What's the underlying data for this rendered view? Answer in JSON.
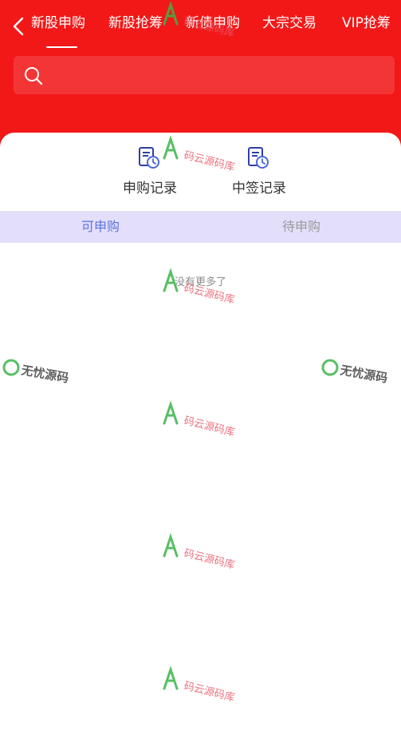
{
  "header": {
    "tabs": [
      {
        "label": "新股申购",
        "active": true
      },
      {
        "label": "新股抢筹",
        "active": false
      },
      {
        "label": "新债申购",
        "active": false
      },
      {
        "label": "大宗交易",
        "active": false
      },
      {
        "label": "VIP抢筹",
        "active": false
      }
    ],
    "search": {
      "placeholder": "",
      "value": ""
    }
  },
  "records": [
    {
      "label": "申购记录",
      "icon": "document-clock-icon"
    },
    {
      "label": "中签记录",
      "icon": "document-clock-icon"
    }
  ],
  "sub_tabs": [
    {
      "label": "可申购",
      "active": true
    },
    {
      "label": "待申购",
      "active": false
    }
  ],
  "list": {
    "empty_text": "没有更多了"
  },
  "watermarks": {
    "primary": "码云源码库",
    "secondary": "无忧源码"
  },
  "colors": {
    "header_red": "#f31818",
    "search_bg": "#f43535",
    "subtab_bg": "#e3dffb",
    "subtab_active": "#5b73e0",
    "icon_blue": "#2f3fa8"
  }
}
